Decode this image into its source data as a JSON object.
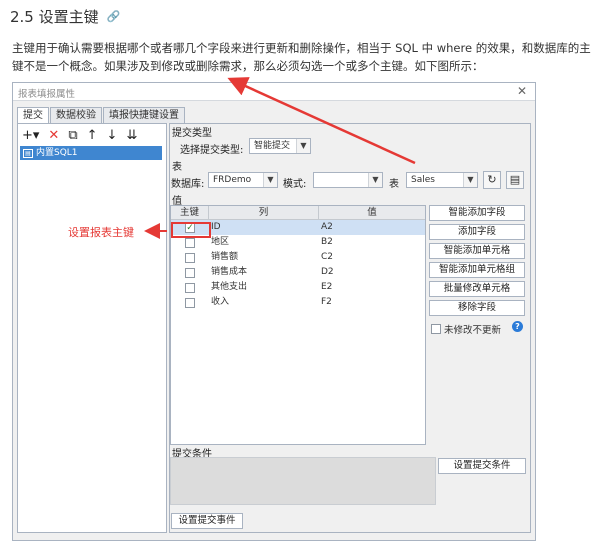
{
  "heading": {
    "title": "2.5 设置主键",
    "link_icon": "link-icon"
  },
  "paragraph": "主键用于确认需要根据哪个或者哪几个字段来进行更新和删除操作，相当于 SQL 中 where 的效果，和数据库的主键不是一个概念。如果涉及到修改或删除需求，那么必须勾选一个或多个主键。如下图所示：",
  "dialog": {
    "title": "报表填报属性",
    "close": "✕",
    "tabs": [
      "提交",
      "数据校验",
      "填报快捷键设置"
    ],
    "toolbar_icons": [
      "add-icon",
      "delete-icon",
      "copy-icon",
      "move-up-icon",
      "move-down-icon",
      "sort-icon"
    ],
    "tree_item": "内置SQL1",
    "submit_type_section": "提交类型",
    "submit_type_label": "选择提交类型:",
    "submit_type_value": "智能提交",
    "table_section": "表",
    "database_label": "数据库:",
    "database_value": "FRDemo",
    "schema_label": "模式:",
    "schema_value": "",
    "table_label": "表",
    "table_value": "Sales",
    "value_section": "值",
    "grid_headers": [
      "主键",
      "列",
      "值"
    ],
    "grid_rows": [
      {
        "key": true,
        "column": "ID",
        "value": "A2"
      },
      {
        "key": false,
        "column": "地区",
        "value": "B2"
      },
      {
        "key": false,
        "column": "销售额",
        "value": "C2"
      },
      {
        "key": false,
        "column": "销售成本",
        "value": "D2"
      },
      {
        "key": false,
        "column": "其他支出",
        "value": "E2"
      },
      {
        "key": false,
        "column": "收入",
        "value": "F2"
      }
    ],
    "side_buttons": [
      "智能添加字段",
      "添加字段",
      "智能添加单元格",
      "智能添加单元格组",
      "批量修改单元格",
      "移除字段"
    ],
    "no_change_label": "未修改不更新",
    "help_icon": "?",
    "condition_section": "提交条件",
    "condition_button": "设置提交条件",
    "event_button": "设置提交事件"
  },
  "annotation": {
    "label": "设置报表主键",
    "color": "#e53935"
  }
}
